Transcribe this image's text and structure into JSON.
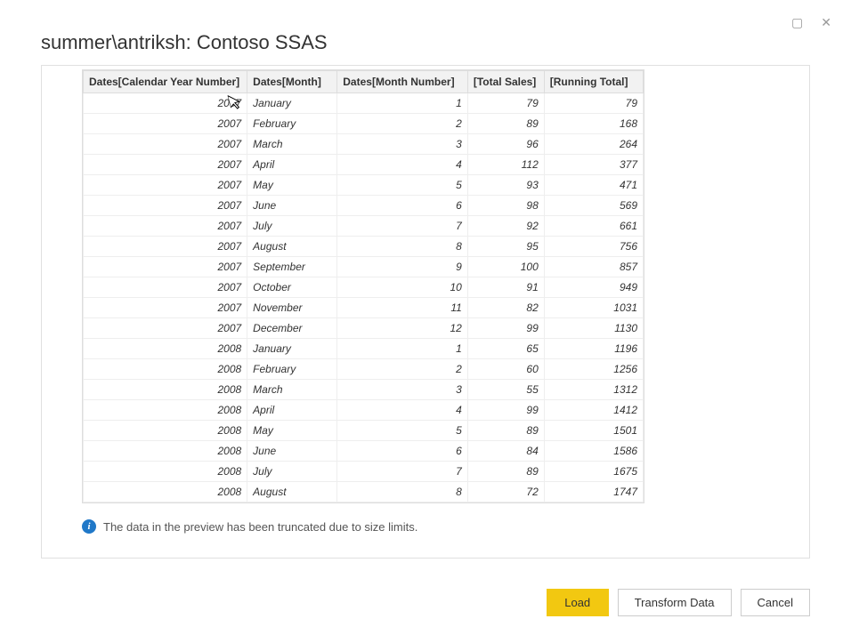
{
  "window": {
    "maximize_glyph": "▢",
    "close_glyph": "✕"
  },
  "dialog": {
    "title": "summer\\antriksh: Contoso SSAS"
  },
  "table": {
    "columns": [
      "Dates[Calendar Year Number]",
      "Dates[Month]",
      "Dates[Month Number]",
      "[Total Sales]",
      "[Running Total]"
    ],
    "rows": [
      {
        "year": "2007",
        "month": "January",
        "month_num": "1",
        "total": "79",
        "running": "79"
      },
      {
        "year": "2007",
        "month": "February",
        "month_num": "2",
        "total": "89",
        "running": "168"
      },
      {
        "year": "2007",
        "month": "March",
        "month_num": "3",
        "total": "96",
        "running": "264"
      },
      {
        "year": "2007",
        "month": "April",
        "month_num": "4",
        "total": "112",
        "running": "377"
      },
      {
        "year": "2007",
        "month": "May",
        "month_num": "5",
        "total": "93",
        "running": "471"
      },
      {
        "year": "2007",
        "month": "June",
        "month_num": "6",
        "total": "98",
        "running": "569"
      },
      {
        "year": "2007",
        "month": "July",
        "month_num": "7",
        "total": "92",
        "running": "661"
      },
      {
        "year": "2007",
        "month": "August",
        "month_num": "8",
        "total": "95",
        "running": "756"
      },
      {
        "year": "2007",
        "month": "September",
        "month_num": "9",
        "total": "100",
        "running": "857"
      },
      {
        "year": "2007",
        "month": "October",
        "month_num": "10",
        "total": "91",
        "running": "949"
      },
      {
        "year": "2007",
        "month": "November",
        "month_num": "11",
        "total": "82",
        "running": "1031"
      },
      {
        "year": "2007",
        "month": "December",
        "month_num": "12",
        "total": "99",
        "running": "1130"
      },
      {
        "year": "2008",
        "month": "January",
        "month_num": "1",
        "total": "65",
        "running": "1196"
      },
      {
        "year": "2008",
        "month": "February",
        "month_num": "2",
        "total": "60",
        "running": "1256"
      },
      {
        "year": "2008",
        "month": "March",
        "month_num": "3",
        "total": "55",
        "running": "1312"
      },
      {
        "year": "2008",
        "month": "April",
        "month_num": "4",
        "total": "99",
        "running": "1412"
      },
      {
        "year": "2008",
        "month": "May",
        "month_num": "5",
        "total": "89",
        "running": "1501"
      },
      {
        "year": "2008",
        "month": "June",
        "month_num": "6",
        "total": "84",
        "running": "1586"
      },
      {
        "year": "2008",
        "month": "July",
        "month_num": "7",
        "total": "89",
        "running": "1675"
      },
      {
        "year": "2008",
        "month": "August",
        "month_num": "8",
        "total": "72",
        "running": "1747"
      }
    ]
  },
  "info": {
    "icon_glyph": "i",
    "message": "The data in the preview has been truncated due to size limits."
  },
  "buttons": {
    "load": "Load",
    "transform": "Transform Data",
    "cancel": "Cancel"
  }
}
